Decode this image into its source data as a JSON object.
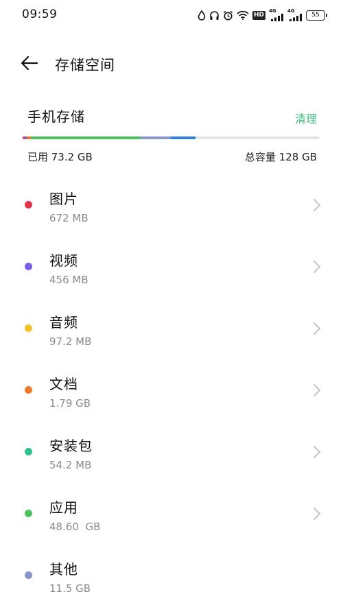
{
  "status_bar": {
    "time": "09:59",
    "network_label_1": "4G",
    "network_label_2": "4G",
    "hd_label": "HD",
    "battery": "55"
  },
  "header": {
    "title": "存储空间",
    "back_icon": "arrow-left-icon"
  },
  "storage": {
    "section_title": "手机存储",
    "clean_label": "清理",
    "used_label": "已用 73.2 GB",
    "total_label": "总容量 128 GB",
    "used_fraction": 0.572,
    "track_color": "#e4e4e4"
  },
  "categories": [
    {
      "name": "图片",
      "size": "672 MB",
      "color": "#e0364a"
    },
    {
      "name": "视频",
      "size": "456 MB",
      "color": "#7b5de8"
    },
    {
      "name": "音频",
      "size": "97.2 MB",
      "color": "#f5c02c"
    },
    {
      "name": "文档",
      "size": "1.79 GB",
      "color": "#f07a2a"
    },
    {
      "name": "安装包",
      "size": "54.2 MB",
      "color": "#2fc48a"
    },
    {
      "name": "应用",
      "size": "48.60  GB",
      "color": "#4cc25d"
    },
    {
      "name": "其他",
      "size": "11.5 GB",
      "color": "#8796c9"
    }
  ],
  "bar_colors": {
    "images": "#e0364a",
    "videos": "#7b5de8",
    "docs": "#f07a2a",
    "apps": "#4cc25d",
    "other": "#8796c9",
    "system": "#2f7fe0"
  },
  "accent_color": "#3dba7e"
}
